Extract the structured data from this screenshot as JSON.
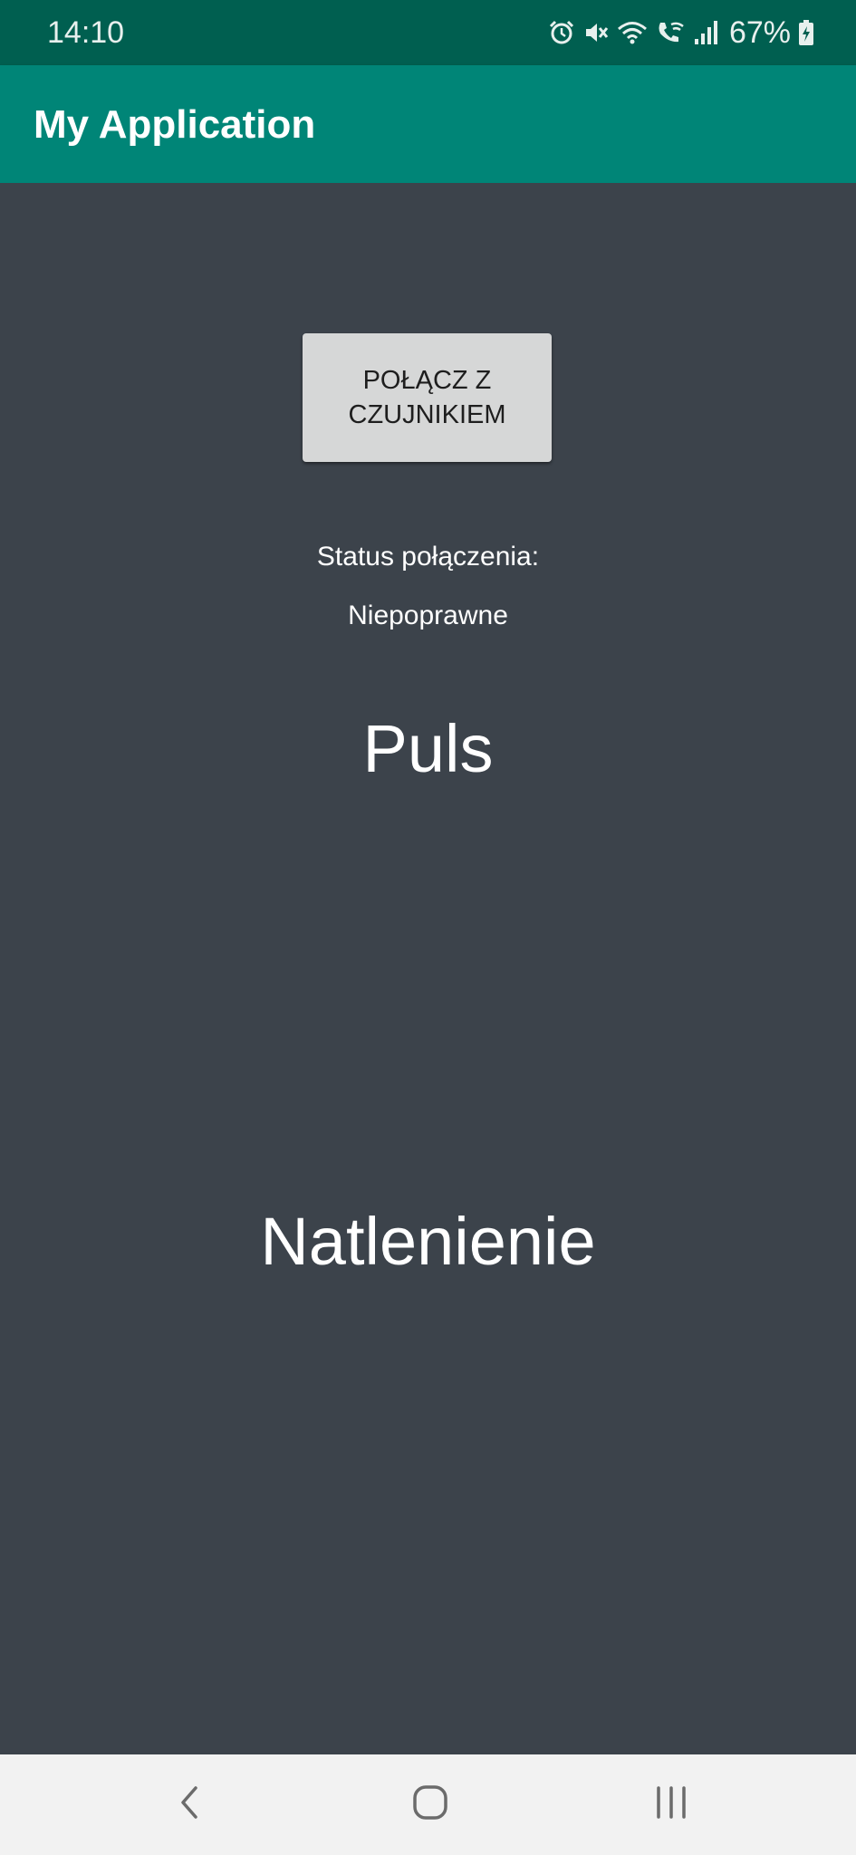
{
  "status_bar": {
    "time": "14:10",
    "battery_percent": "67%",
    "icons": [
      "alarm-icon",
      "mute-icon",
      "wifi-icon",
      "wifi-calling-icon",
      "signal-icon",
      "battery-charging-icon"
    ]
  },
  "app_bar": {
    "title": "My Application"
  },
  "main": {
    "connect_button_label": "POŁĄCZ Z CZUJNIKIEM",
    "status_label": "Status połączenia:",
    "status_value": "Niepoprawne",
    "pulse_label": "Puls",
    "oxygen_label": "Natlenienie"
  },
  "nav_bar": {
    "buttons": [
      "back-icon",
      "home-icon",
      "recents-icon"
    ]
  },
  "colors": {
    "status_bar": "#005f50",
    "app_bar": "#008577",
    "background": "#3c434b",
    "button": "#d6d7d7",
    "nav_bar": "#f2f2f2"
  }
}
